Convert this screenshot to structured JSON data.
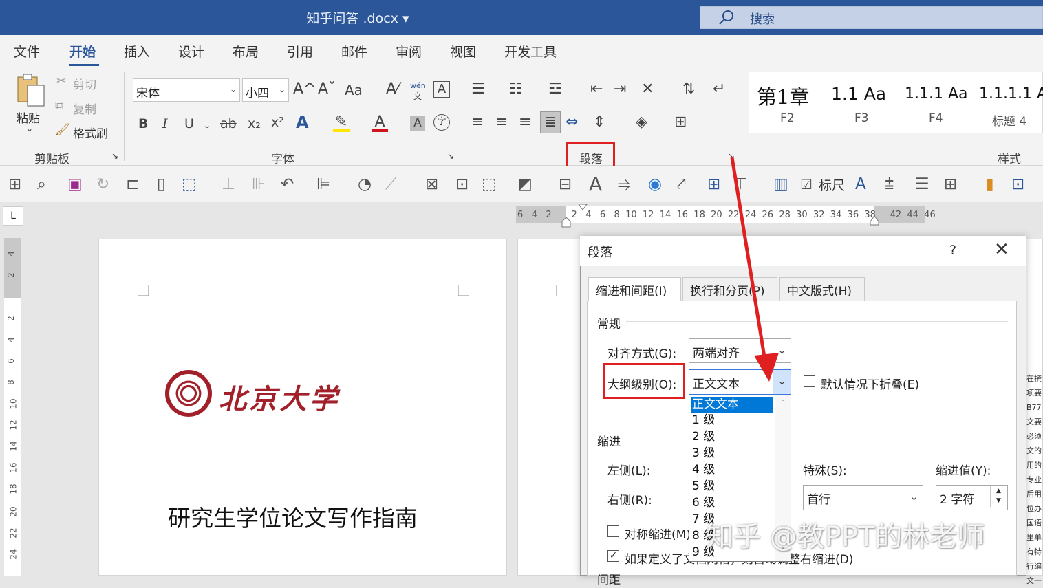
{
  "titlebar": {
    "doc_title": "知乎问答 .docx ▾",
    "search_placeholder": "搜索"
  },
  "tabs": [
    "文件",
    "开始",
    "插入",
    "设计",
    "布局",
    "引用",
    "邮件",
    "审阅",
    "视图",
    "开发工具"
  ],
  "active_tab": "开始",
  "clipboard": {
    "paste": "粘贴",
    "cut": "剪切",
    "copy": "复制",
    "format_painter": "格式刷",
    "group_label": "剪贴板"
  },
  "font": {
    "name": "宋体",
    "size": "小四",
    "group_label": "字体",
    "grow": "A^",
    "shrink": "Aˇ",
    "case": "Aa",
    "bold": "B",
    "italic": "I",
    "underline": "U",
    "strike": "ab",
    "subscript": "x₂",
    "superscript": "x²",
    "wen": "wén",
    "wen_char": "文"
  },
  "paragraph": {
    "group_label": "段落",
    "highlight_color": "#e02020"
  },
  "styles": {
    "group_label": "样式",
    "items": [
      {
        "preview": "第1章",
        "label": "F2"
      },
      {
        "preview": "1.1  Aa",
        "label": "F3"
      },
      {
        "preview": "1.1.1  Aa",
        "label": "F4"
      },
      {
        "preview": "1.1.1.1  A",
        "label": "标题 4"
      }
    ]
  },
  "qat": {
    "ruler_label": "标尺"
  },
  "ruler": {
    "numbers": "6   4   2       2   4   6   8  10  12  14  16  18  20  22  24  26  28  30  32  34  36  38     42  44  46"
  },
  "vruler": {
    "numbers": [
      "4",
      "2",
      "2",
      "4",
      "6",
      "8",
      "10",
      "12",
      "14",
      "16",
      "18",
      "20",
      "22",
      "24"
    ]
  },
  "document": {
    "logo_text": "北京大学",
    "heading": "研究生学位论文写作指南"
  },
  "dialog": {
    "title": "段落",
    "help": "?",
    "close": "✕",
    "tabs": [
      "缩进和间距(I)",
      "换行和分页(P)",
      "中文版式(H)"
    ],
    "general_label": "常规",
    "alignment_label": "对齐方式(G):",
    "alignment_value": "两端对齐",
    "outline_label": "大纲级别(O):",
    "outline_value": "正文文本",
    "collapse_label": "默认情况下折叠(E)",
    "indent_label": "缩进",
    "left_label": "左侧(L):",
    "right_label": "右侧(R):",
    "special_label": "特殊(S):",
    "special_value": "首行",
    "indent_by_label": "缩进值(Y):",
    "indent_by_value": "2 字符",
    "mirror_label": "对称缩进(M)",
    "grid_label": "如果定义了文档网格，则自动调整右缩进(D)",
    "grid_checked": true,
    "spacing_label": "间距",
    "outline_options": [
      "正文文本",
      "1 级",
      "2 级",
      "3 级",
      "4 级",
      "5 级",
      "6 级",
      "7 级",
      "8 级",
      "9 级"
    ]
  },
  "watermark": "知乎 @教PPT的林老师",
  "side_text": [
    "在撰",
    "项要",
    "B77",
    "文要",
    "必须",
    "文的",
    "用的",
    "专业",
    "后用",
    "位办",
    "国语",
    "里单",
    "有特",
    "行编",
    "文一"
  ],
  "colors": {
    "brand": "#2b579a",
    "highlight": "#e02020",
    "selected": "#0078d7"
  }
}
